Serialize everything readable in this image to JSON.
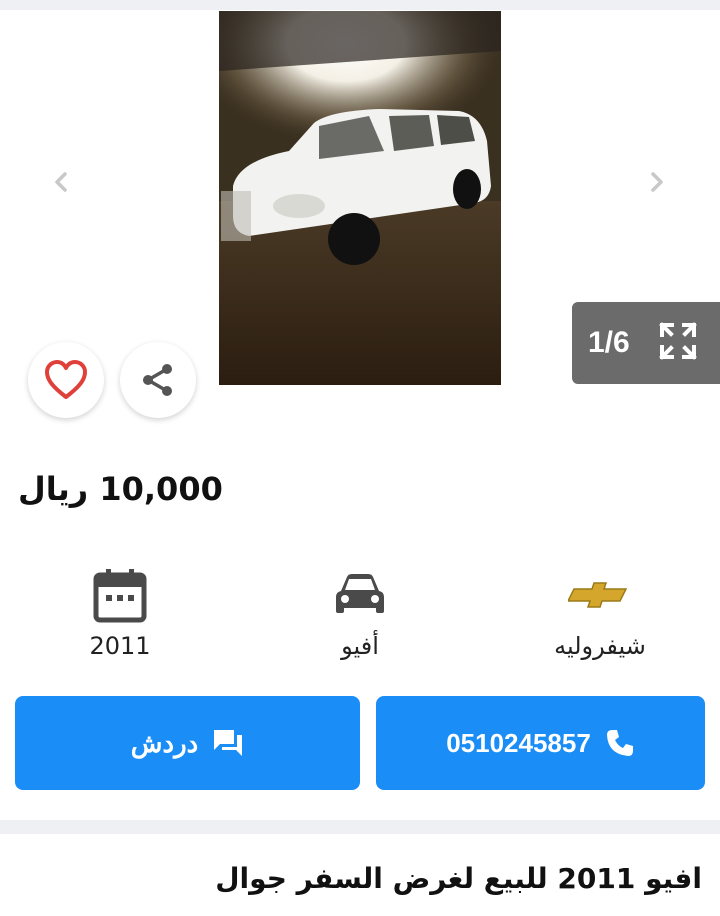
{
  "gallery": {
    "counter": "1/6",
    "prev_icon": "chevron-left-icon",
    "next_icon": "chevron-right-icon",
    "expand_icon": "fullscreen-icon"
  },
  "actions": {
    "favorite_icon": "heart-icon",
    "share_icon": "share-icon"
  },
  "price": {
    "text": "10,000 ريال"
  },
  "specs": [
    {
      "icon": "calendar-icon",
      "label": "2011"
    },
    {
      "icon": "car-icon",
      "label": "أفيو"
    },
    {
      "icon": "chevrolet-logo",
      "label": "شيفروليه"
    }
  ],
  "buttons": {
    "chat_label": "دردش",
    "phone_label": "0510245857"
  },
  "listing": {
    "title": "افيو 2011 للبيع لغرض السفر جوال"
  },
  "colors": {
    "accent": "#1a8ef6",
    "heart": "#e0403a",
    "counter_bg": "#6b6b6b"
  }
}
